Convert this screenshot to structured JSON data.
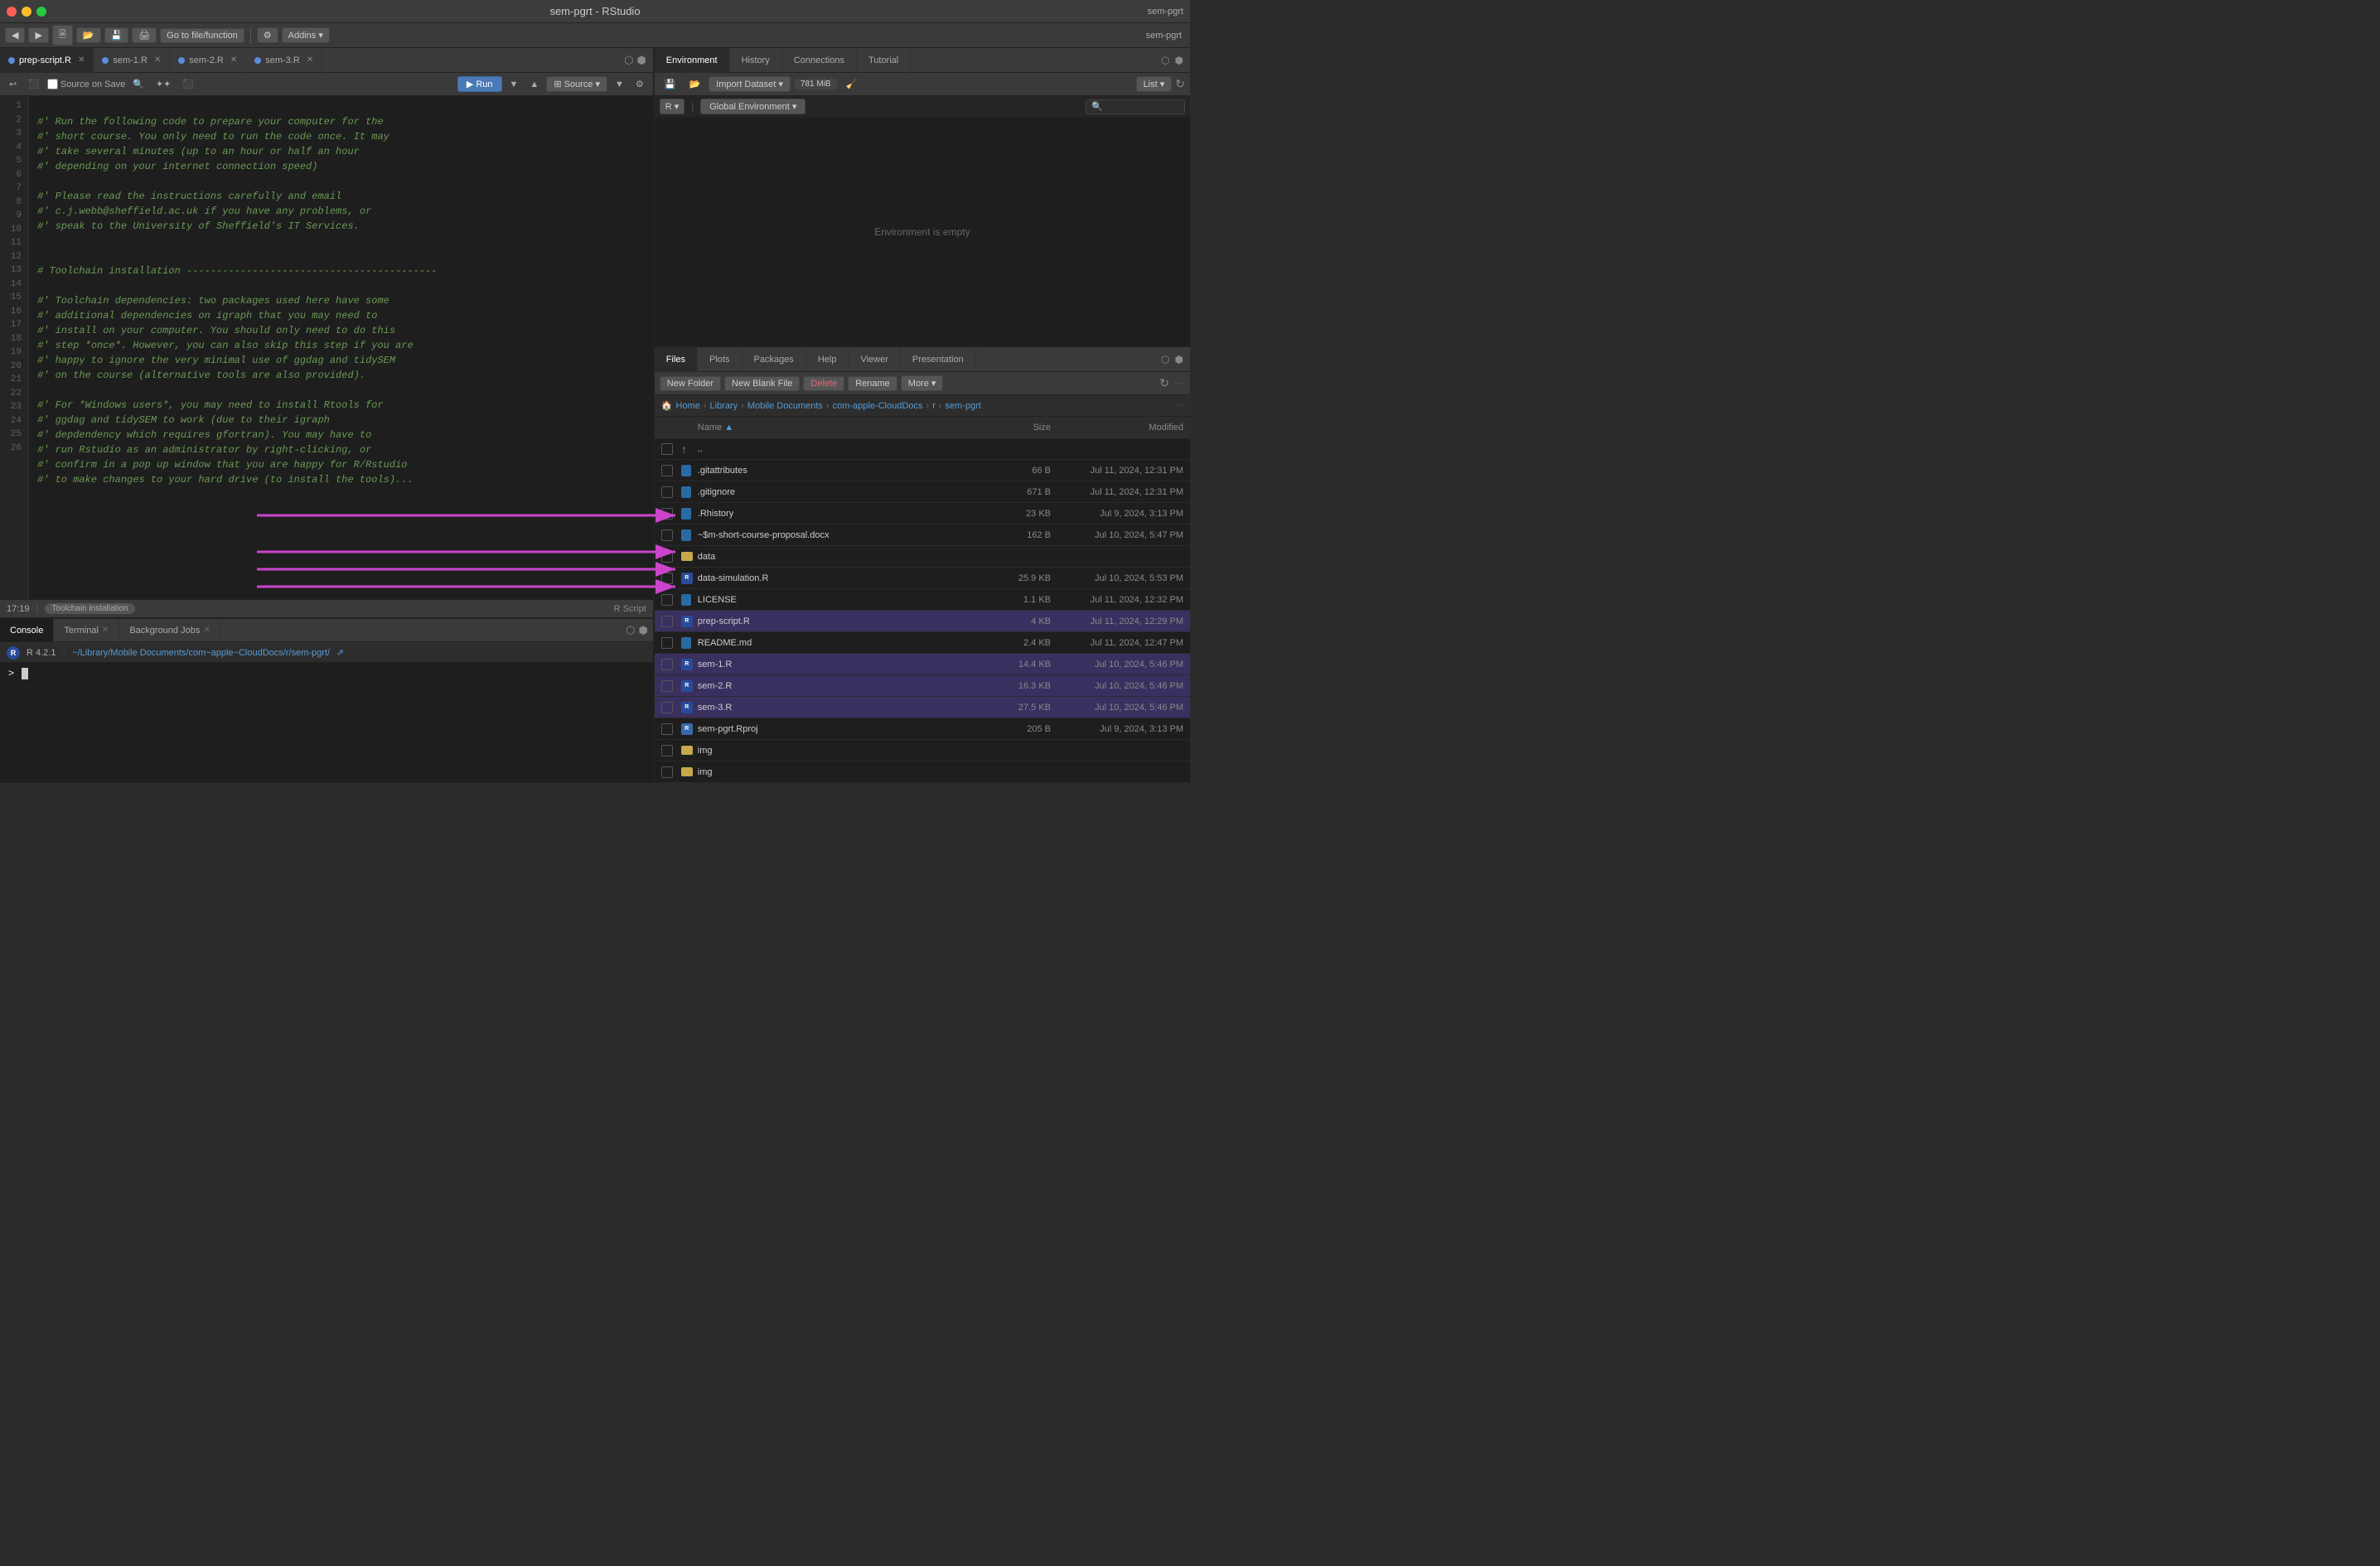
{
  "app": {
    "title": "sem-pgrt - RStudio",
    "user": "sem-pgrt"
  },
  "toolbar": {
    "back_label": "◀",
    "forward_label": "▶",
    "new_label": "🗎",
    "open_label": "📂",
    "save_label": "💾",
    "print_label": "🖨",
    "go_to_file": "Go to file/function",
    "addins_label": "Addins ▾"
  },
  "editor": {
    "tabs": [
      {
        "label": "prep-script.R",
        "active": true,
        "modified": false
      },
      {
        "label": "sem-1.R",
        "active": false,
        "modified": false
      },
      {
        "label": "sem-2.R",
        "active": false,
        "modified": false
      },
      {
        "label": "sem-3.R",
        "active": false,
        "modified": false
      }
    ],
    "toolbar": {
      "source_on_save": "Source on Save",
      "run_label": "▶ Run",
      "source_label": "⊞ Source ▾"
    },
    "status": {
      "position": "17:19",
      "section": "Toolchain installation",
      "script_type": "R Script"
    },
    "code_lines": [
      {
        "num": 1,
        "text": ""
      },
      {
        "num": 2,
        "text": "#' Run the following code to prepare your computer for the"
      },
      {
        "num": 3,
        "text": "#' short course. You only need to run the code once. It may"
      },
      {
        "num": 4,
        "text": "#' take several minutes (up to an hour or half an hour"
      },
      {
        "num": 5,
        "text": "#' depending on your internet connection speed)"
      },
      {
        "num": 6,
        "text": ""
      },
      {
        "num": 7,
        "text": "#' Please read the instructions carefully and email"
      },
      {
        "num": 8,
        "text": "#' c.j.webb@sheffield.ac.uk if you have any problems, or"
      },
      {
        "num": 9,
        "text": "#' speak to the University of Sheffield's IT Services."
      },
      {
        "num": 10,
        "text": ""
      },
      {
        "num": 11,
        "text": ""
      },
      {
        "num": 12,
        "text": "# Toolchain installation ------------------------------------------"
      },
      {
        "num": 13,
        "text": ""
      },
      {
        "num": 14,
        "text": "#' Toolchain dependencies: two packages used here have some"
      },
      {
        "num": 15,
        "text": "#' additional dependencies on igraph that you may need to"
      },
      {
        "num": 16,
        "text": "#' install on your computer. You should only need to do this"
      },
      {
        "num": 17,
        "text": "#' step *once*. However, you can also skip this step if you are"
      },
      {
        "num": 18,
        "text": "#' happy to ignore the very minimal use of ggdag and tidySEM"
      },
      {
        "num": 19,
        "text": "#' on the course (alternative tools are also provided)."
      },
      {
        "num": 20,
        "text": ""
      },
      {
        "num": 21,
        "text": "#' For *Windows users*, you may need to install Rtools for"
      },
      {
        "num": 22,
        "text": "#' ggdag and tidySEM to work (due to their igraph"
      },
      {
        "num": 23,
        "text": "#' depdendency which requires gfortran). You may have to"
      },
      {
        "num": 24,
        "text": "#' run Rstudio as an administrator by right-clicking, or"
      },
      {
        "num": 25,
        "text": "#' confirm in a pop up window that you are happy for R/Rstudio"
      },
      {
        "num": 26,
        "text": "#' to make changes to your hard drive (to install the tools)..."
      }
    ]
  },
  "console": {
    "tabs": [
      {
        "label": "Console",
        "active": true
      },
      {
        "label": "Terminal",
        "active": false
      },
      {
        "label": "Background Jobs",
        "active": false
      }
    ],
    "r_version": "R 4.2.1",
    "path": "~/Library/Mobile Documents/com~apple~CloudDocs/r/sem-pgrt/",
    "prompt": ">"
  },
  "environment": {
    "tabs": [
      {
        "label": "Environment",
        "active": true
      },
      {
        "label": "History",
        "active": false
      },
      {
        "label": "Connections",
        "active": false
      },
      {
        "label": "Tutorial",
        "active": false
      }
    ],
    "toolbar": {
      "import_label": "Import Dataset ▾",
      "memory": "781 MiB",
      "list_label": "List ▾"
    },
    "r_env": "R ▾",
    "global_env": "Global Environment ▾",
    "empty_message": "Environment is empty"
  },
  "files": {
    "tabs": [
      {
        "label": "Files",
        "active": true
      },
      {
        "label": "Plots",
        "active": false
      },
      {
        "label": "Packages",
        "active": false
      },
      {
        "label": "Help",
        "active": false
      },
      {
        "label": "Viewer",
        "active": false
      },
      {
        "label": "Presentation",
        "active": false
      }
    ],
    "toolbar": {
      "new_folder": "New Folder",
      "new_blank_file": "New Blank File",
      "delete": "Delete",
      "rename": "Rename",
      "more": "More ▾"
    },
    "breadcrumb": "Home > Library > Mobile Documents > com-apple-CloudDocs > r > sem-pgrt",
    "columns": {
      "name": "Name",
      "size": "Size",
      "modified": "Modified"
    },
    "items": [
      {
        "name": "..",
        "type": "up",
        "size": "",
        "date": ""
      },
      {
        "name": ".gitattributes",
        "type": "file",
        "size": "66 B",
        "date": "Jul 11, 2024, 12:31 PM",
        "highlighted": false
      },
      {
        "name": ".gitignore",
        "type": "file",
        "size": "671 B",
        "date": "Jul 11, 2024, 12:31 PM",
        "highlighted": false
      },
      {
        "name": ".Rhistory",
        "type": "file",
        "size": "23 KB",
        "date": "Jul 9, 2024, 3:13 PM",
        "highlighted": false
      },
      {
        "name": "~$m-short-course-proposal.docx",
        "type": "doc",
        "size": "162 B",
        "date": "Jul 10, 2024, 5:47 PM",
        "highlighted": false
      },
      {
        "name": "data",
        "type": "folder",
        "size": "",
        "date": "",
        "highlighted": false
      },
      {
        "name": "data-simulation.R",
        "type": "r",
        "size": "25.9 KB",
        "date": "Jul 10, 2024, 5:53 PM",
        "highlighted": false
      },
      {
        "name": "LICENSE",
        "type": "file",
        "size": "1.1 KB",
        "date": "Jul 11, 2024, 12:32 PM",
        "highlighted": false
      },
      {
        "name": "prep-script.R",
        "type": "r",
        "size": "4 KB",
        "date": "Jul 11, 2024, 12:29 PM",
        "highlighted": true
      },
      {
        "name": "README.md",
        "type": "file",
        "size": "2.4 KB",
        "date": "Jul 11, 2024, 12:47 PM",
        "highlighted": false
      },
      {
        "name": "sem-1.R",
        "type": "r",
        "size": "14.4 KB",
        "date": "Jul 10, 2024, 5:46 PM",
        "highlighted": true
      },
      {
        "name": "sem-2.R",
        "type": "r",
        "size": "16.3 KB",
        "date": "Jul 10, 2024, 5:46 PM",
        "highlighted": true
      },
      {
        "name": "sem-3.R",
        "type": "r",
        "size": "27.5 KB",
        "date": "Jul 10, 2024, 5:46 PM",
        "highlighted": true
      },
      {
        "name": "sem-pgrt.Rproj",
        "type": "rproj",
        "size": "205 B",
        "date": "Jul 9, 2024, 3:13 PM",
        "highlighted": false
      },
      {
        "name": "img",
        "type": "folder",
        "size": "",
        "date": "",
        "highlighted": false
      },
      {
        "name": "img",
        "type": "folder",
        "size": "",
        "date": "",
        "highlighted": false
      }
    ]
  }
}
